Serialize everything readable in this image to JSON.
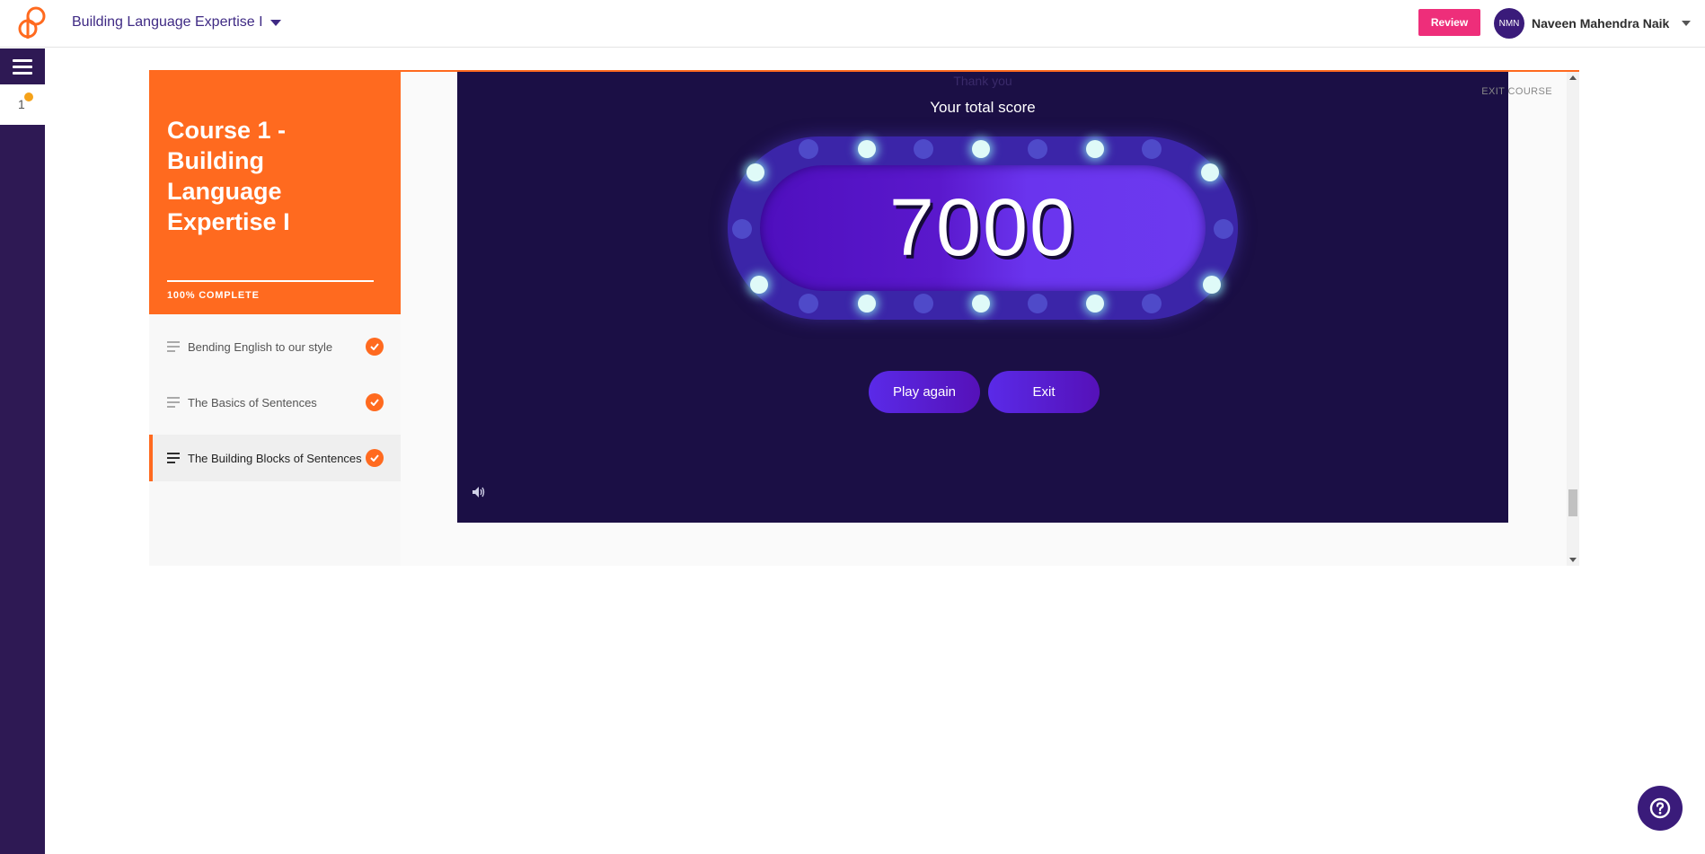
{
  "header": {
    "course_title": "Building Language Expertise I",
    "review_label": "Review",
    "user_initials": "NMN",
    "user_name": "Naveen Mahendra Naik"
  },
  "rail": {
    "notification_count": "1"
  },
  "course": {
    "title": "Course 1 - Building Language Expertise I",
    "progress_text": "100% COMPLETE",
    "progress_fraction": 1.0,
    "lessons": [
      {
        "label": "Bending English to our style",
        "completed": true,
        "active": false
      },
      {
        "label": "The Basics of Sentences",
        "completed": true,
        "active": false
      },
      {
        "label": "The Building Blocks of Sentences",
        "completed": true,
        "active": true
      }
    ],
    "exit_label": "EXIT COURSE"
  },
  "game": {
    "top_partial_text": "Thank you",
    "score_label": "Your total score",
    "score_value": "7000",
    "play_again_label": "Play again",
    "exit_label": "Exit"
  },
  "colors": {
    "brand_orange": "#ff6a1f",
    "brand_purple": "#3a1b7a",
    "review_pink": "#ee2e7a",
    "stage_bg": "#1b0f45"
  },
  "icons": [
    "logo-icon",
    "chevron-down-icon",
    "hamburger-icon",
    "check-icon",
    "lesson-lines-icon",
    "speaker-icon",
    "help-icon"
  ]
}
